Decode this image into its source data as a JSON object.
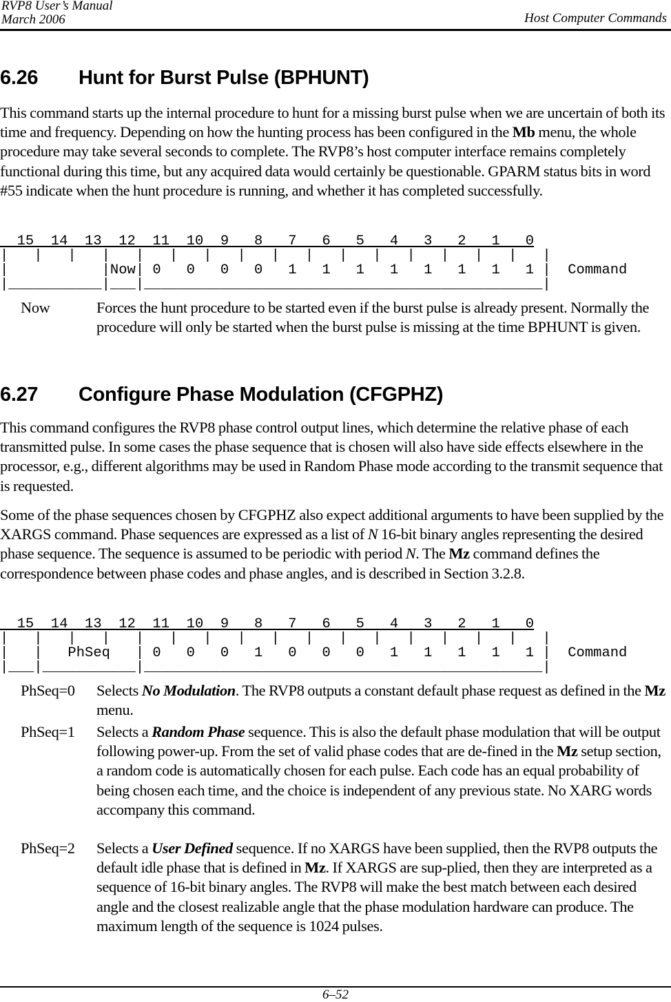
{
  "header": {
    "manual_title": "RVP8 User’s Manual",
    "date": "March 2006",
    "chapter": "Host Computer Commands"
  },
  "sections": [
    {
      "number": "6.26",
      "title": "Hunt for Burst Pulse (BPHUNT)",
      "paragraphs": [
        {
          "t1": "This command starts up the internal procedure to hunt for a missing burst pulse when we are uncertain of both its time and frequency.  Depending on how the hunting process has been configured in the ",
          "b1": "Mb",
          "t2": " menu, the whole procedure may take several seconds to complete.  The RVP8’s host computer interface remains completely functional during this time, but any acquired data would certainly be questionable.  GPARM status bits in word #55 indicate when the hunt procedure is running, and whether it has completed successfully."
        }
      ],
      "register": {
        "bit_numbers": "  15  14  13  12  11  10  9   8   7   6   5   4   3   2   1   0",
        "line1": "|   |   |   |   |   |   |   |   |   |   |   |   |   |   |   |   |",
        "line2": "|           |Now| 0   0   0   0   1   1   1   1   1   1   1   1 |  Command",
        "line3": "|___________|___|_______________________________________________|",
        "fields": [
          {
            "bits": "15-13",
            "name": ""
          },
          {
            "bits": "12",
            "name": "Now"
          },
          {
            "bits": "11-0",
            "name": "Command",
            "value": "000011111111"
          }
        ],
        "label": "Command"
      },
      "definitions": [
        {
          "term": "Now",
          "text": "Forces the hunt procedure to be started even if the burst pulse is already present.  Normally the procedure will only be started when the burst pulse is missing at the time BPHUNT is given."
        }
      ]
    },
    {
      "number": "6.27",
      "title": "Configure Phase Modulation (CFGPHZ)",
      "paragraphs": [
        {
          "t1": "This command configures the RVP8 phase control output lines, which determine the relative phase of each transmitted pulse.  In some cases the phase sequence that is chosen will also have side effects elsewhere in the processor, e.g., different algorithms may be used in Random Phase mode according to the transmit sequence that is requested."
        },
        {
          "t1": "Some of the phase sequences chosen by CFGPHZ also expect additional arguments to have been supplied by the XARGS command.  Phase sequences are expressed as a list of ",
          "i1": "N",
          "t2": " 16-bit binary angles representing the desired phase sequence.  The sequence is assumed to be periodic with period ",
          "i2": "N",
          "t3": ".  The ",
          "b1": "Mz",
          "t4": " command defines the correspondence between phase codes and phase angles, and is described in Section 3.2.8."
        }
      ],
      "register": {
        "bit_numbers": "  15  14  13  12  11  10  9   8   7   6   5   4   3   2   1   0",
        "line1": "|   |   |   |   |   |   |   |   |   |   |   |   |   |   |   |   |",
        "line2": "|   |   PhSeq   | 0   0   0   1   0   0   0   1   1   1   1   1 |  Command",
        "line3": "|___|___________|_______________________________________________|",
        "fields": [
          {
            "bits": "15",
            "name": ""
          },
          {
            "bits": "14-12",
            "name": "PhSeq"
          },
          {
            "bits": "11-0",
            "name": "Command",
            "value": "000100011111"
          }
        ],
        "label": "Command"
      },
      "definitions": [
        {
          "term": "PhSeq=0",
          "t1": "Selects ",
          "bi1": "No Modulation",
          "t2": ".  The RVP8 outputs a constant default phase request as defined in the ",
          "b1": "Mz",
          "t3": " menu."
        },
        {
          "term": "PhSeq=1",
          "t1": "Selects a ",
          "bi1": "Random Phase",
          "t2": " sequence.  This is also the default phase modulation that will be output following power-up.  From the set of valid phase codes that are de-fined in the ",
          "b1": "Mz",
          "t3": " setup section, a random code is automatically chosen for each pulse.  Each code has an equal probability of being chosen each time, and the choice is independent of any previous state.  No XARG words accompany this command."
        },
        {
          "term": "PhSeq=2",
          "t1": "Selects a ",
          "bi1": "User Defined",
          "t2": " sequence.  If no XARGS have been supplied, then the RVP8 outputs the default idle phase that is defined in ",
          "b1": "Mz",
          "t3": ".  If XARGS are sup-plied, then they are interpreted as a sequence of 16-bit binary angles.  The RVP8 will make the best match between each desired angle and the closest realizable angle that the phase modulation hardware can produce.  The maximum length of the sequence is 1024 pulses."
        }
      ]
    }
  ],
  "footer": {
    "page_number": "6–52"
  }
}
